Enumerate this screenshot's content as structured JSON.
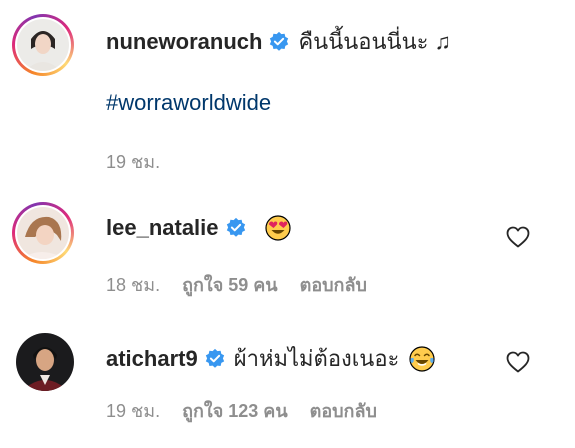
{
  "comments": [
    {
      "username": "nuneworanuch",
      "verified": true,
      "text": "คืนนี้นอนนี่นะ ♫",
      "hashtag": "#worraworldwide",
      "time": "19 ชม."
    },
    {
      "username": "lee_natalie",
      "verified": true,
      "emoji": "heart-eyes-emoji",
      "time": "18 ชม.",
      "likes": "ถูกใจ 59 คน",
      "reply": "ตอบกลับ"
    },
    {
      "username": "atichart9",
      "verified": true,
      "text": "ผ้าห่มไม่ต้องเนอะ",
      "emoji": "tears-of-joy-emoji",
      "time": "19 ชม.",
      "likes": "ถูกใจ 123 คน",
      "reply": "ตอบกลับ"
    }
  ],
  "colors": {
    "text": "#262626",
    "muted": "#8e8e8e",
    "hashtag": "#00376b",
    "verified": "#3897f0"
  }
}
